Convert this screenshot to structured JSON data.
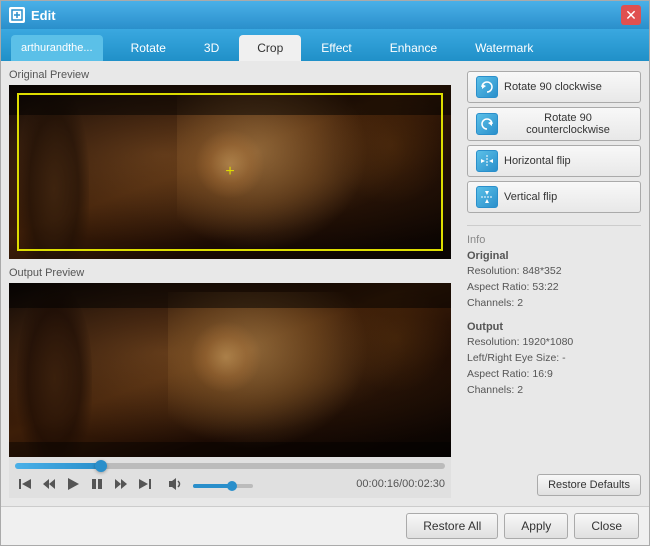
{
  "window": {
    "title": "Edit",
    "icon": "✎"
  },
  "file_tab": {
    "label": "arthurandthe..."
  },
  "tabs": [
    {
      "id": "rotate",
      "label": "Rotate",
      "active": false
    },
    {
      "id": "3d",
      "label": "3D",
      "active": false
    },
    {
      "id": "crop",
      "label": "Crop",
      "active": true
    },
    {
      "id": "effect",
      "label": "Effect",
      "active": false
    },
    {
      "id": "enhance",
      "label": "Enhance",
      "active": false
    },
    {
      "id": "watermark",
      "label": "Watermark",
      "active": false
    }
  ],
  "panels": {
    "original_label": "Original Preview",
    "output_label": "Output Preview"
  },
  "actions": [
    {
      "id": "rotate-cw",
      "label": "Rotate 90 clockwise",
      "icon": "↻"
    },
    {
      "id": "rotate-ccw",
      "label": "Rotate 90 counterclockwise",
      "icon": "↺"
    },
    {
      "id": "h-flip",
      "label": "Horizontal flip",
      "icon": "⇔"
    },
    {
      "id": "v-flip",
      "label": "Vertical flip",
      "icon": "⇕"
    }
  ],
  "info": {
    "section_label": "Info",
    "original": {
      "title": "Original",
      "resolution": "Resolution: 848*352",
      "aspect_ratio": "Aspect Ratio: 53:22",
      "channels": "Channels: 2"
    },
    "output": {
      "title": "Output",
      "resolution": "Resolution: 1920*1080",
      "lr_size": "Left/Right Eye Size: -",
      "aspect_ratio": "Aspect Ratio: 16:9",
      "channels": "Channels: 2"
    }
  },
  "player": {
    "time": "00:00:16/00:02:30",
    "progress_pct": 20,
    "volume_pct": 65
  },
  "buttons": {
    "restore_defaults": "Restore Defaults",
    "restore_all": "Restore All",
    "apply": "Apply",
    "close": "Close"
  }
}
